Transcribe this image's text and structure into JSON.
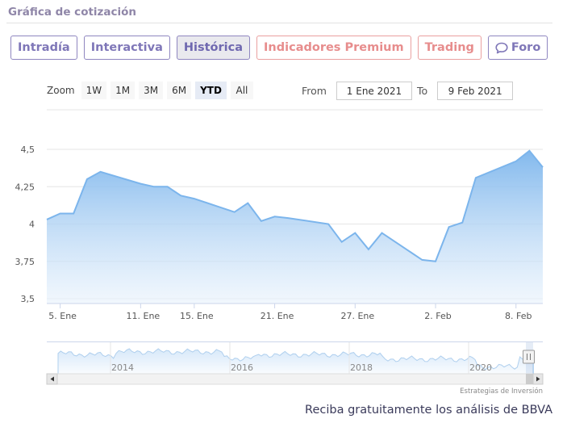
{
  "section_title": "Gráfica de cotización",
  "tabs": [
    {
      "label": "Intradía",
      "state": "normal"
    },
    {
      "label": "Interactiva",
      "state": "normal"
    },
    {
      "label": "Histórica",
      "state": "active"
    },
    {
      "label": "Indicadores Premium",
      "state": "premium"
    },
    {
      "label": "Trading",
      "state": "premium"
    },
    {
      "label": "Foro",
      "state": "normal",
      "icon": "speech-bubble-icon"
    }
  ],
  "zoom": {
    "label": "Zoom",
    "buttons": [
      "1W",
      "1M",
      "3M",
      "6M",
      "YTD",
      "All"
    ],
    "selected": "YTD"
  },
  "range": {
    "from_label": "From",
    "from_value": "1 Ene 2021",
    "to_label": "To",
    "to_value": "9 Feb 2021"
  },
  "colors": {
    "line": "#7cb5ec",
    "fill_top": "#7cb5ec",
    "fill_bottom": "#e8f2fc",
    "tab_border": "#8f86c0",
    "premium": "#e78d8d"
  },
  "chart_data": {
    "type": "area",
    "xlabel": "",
    "ylabel": "",
    "ylim": [
      3.5,
      4.5
    ],
    "y_ticks": [
      3.5,
      3.75,
      4,
      4.25,
      4.5
    ],
    "y_tick_labels": [
      "3,5",
      "3,75",
      "4",
      "4,25",
      "4,5"
    ],
    "x_tick_labels": [
      "5. Ene",
      "11. Ene",
      "15. Ene",
      "21. Ene",
      "27. Ene",
      "2. Feb",
      "8. Feb"
    ],
    "x_tick_dates": [
      "2021-01-05",
      "2021-01-11",
      "2021-01-15",
      "2021-01-21",
      "2021-01-27",
      "2021-02-02",
      "2021-02-08"
    ],
    "series": [
      {
        "values": [
          {
            "x": "2021-01-04",
            "y": 4.03
          },
          {
            "x": "2021-01-05",
            "y": 4.07
          },
          {
            "x": "2021-01-06",
            "y": 4.07
          },
          {
            "x": "2021-01-07",
            "y": 4.3
          },
          {
            "x": "2021-01-08",
            "y": 4.35
          },
          {
            "x": "2021-01-11",
            "y": 4.27
          },
          {
            "x": "2021-01-12",
            "y": 4.25
          },
          {
            "x": "2021-01-13",
            "y": 4.25
          },
          {
            "x": "2021-01-14",
            "y": 4.19
          },
          {
            "x": "2021-01-15",
            "y": 4.17
          },
          {
            "x": "2021-01-18",
            "y": 4.08
          },
          {
            "x": "2021-01-19",
            "y": 4.14
          },
          {
            "x": "2021-01-20",
            "y": 4.02
          },
          {
            "x": "2021-01-21",
            "y": 4.05
          },
          {
            "x": "2021-01-22",
            "y": 4.04
          },
          {
            "x": "2021-01-25",
            "y": 4.0
          },
          {
            "x": "2021-01-26",
            "y": 3.88
          },
          {
            "x": "2021-01-27",
            "y": 3.94
          },
          {
            "x": "2021-01-28",
            "y": 3.83
          },
          {
            "x": "2021-01-29",
            "y": 3.94
          },
          {
            "x": "2021-02-01",
            "y": 3.76
          },
          {
            "x": "2021-02-02",
            "y": 3.75
          },
          {
            "x": "2021-02-03",
            "y": 3.98
          },
          {
            "x": "2021-02-04",
            "y": 4.01
          },
          {
            "x": "2021-02-05",
            "y": 4.31
          },
          {
            "x": "2021-02-08",
            "y": 4.42
          },
          {
            "x": "2021-02-09",
            "y": 4.49
          },
          {
            "x": "2021-02-10",
            "y": 4.38
          }
        ]
      }
    ],
    "navigator": {
      "year_labels": [
        "2014",
        "2016",
        "2018",
        "2020"
      ],
      "credit": "Estrategias de Inversión"
    }
  },
  "footer_text": "Reciba gratuitamente los análisis de BBVA"
}
